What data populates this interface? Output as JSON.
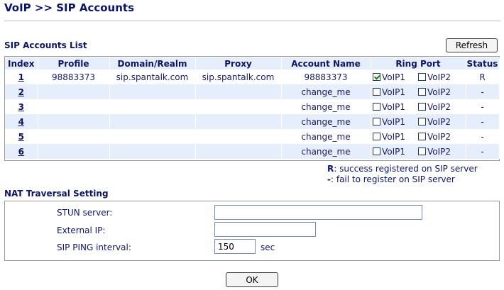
{
  "header": {
    "title": "VoIP >> SIP Accounts"
  },
  "accounts": {
    "section_title": "SIP Accounts List",
    "refresh_label": "Refresh",
    "columns": {
      "index": "Index",
      "profile": "Profile",
      "domain": "Domain/Realm",
      "proxy": "Proxy",
      "account_name": "Account Name",
      "ring_port": "Ring Port",
      "status": "Status"
    },
    "voip1_label": "VoIP1",
    "voip2_label": "VoIP2",
    "rows": [
      {
        "index": "1",
        "profile": "98883373",
        "domain": "sip.spantalk.com",
        "proxy": "sip.spantalk.com",
        "account_name": "98883373",
        "voip1": true,
        "voip2": false,
        "status": "R"
      },
      {
        "index": "2",
        "profile": "",
        "domain": "",
        "proxy": "",
        "account_name": "change_me",
        "voip1": false,
        "voip2": false,
        "status": "-"
      },
      {
        "index": "3",
        "profile": "",
        "domain": "",
        "proxy": "",
        "account_name": "change_me",
        "voip1": false,
        "voip2": false,
        "status": "-"
      },
      {
        "index": "4",
        "profile": "",
        "domain": "",
        "proxy": "",
        "account_name": "change_me",
        "voip1": false,
        "voip2": false,
        "status": "-"
      },
      {
        "index": "5",
        "profile": "",
        "domain": "",
        "proxy": "",
        "account_name": "change_me",
        "voip1": false,
        "voip2": false,
        "status": "-"
      },
      {
        "index": "6",
        "profile": "",
        "domain": "",
        "proxy": "",
        "account_name": "change_me",
        "voip1": false,
        "voip2": false,
        "status": "-"
      }
    ]
  },
  "legend": {
    "r_key": "R",
    "r_text": ":  success registered on SIP server",
    "dash_key": "-",
    "dash_text": ":  fail to register on SIP server"
  },
  "nat": {
    "section_title": "NAT Traversal Setting",
    "stun_label": "STUN server:",
    "stun_value": "",
    "external_ip_label": "External IP:",
    "external_ip_value": "",
    "ping_label": "SIP PING interval:",
    "ping_value": "150",
    "ping_unit": "sec"
  },
  "footer": {
    "ok_label": "OK"
  }
}
